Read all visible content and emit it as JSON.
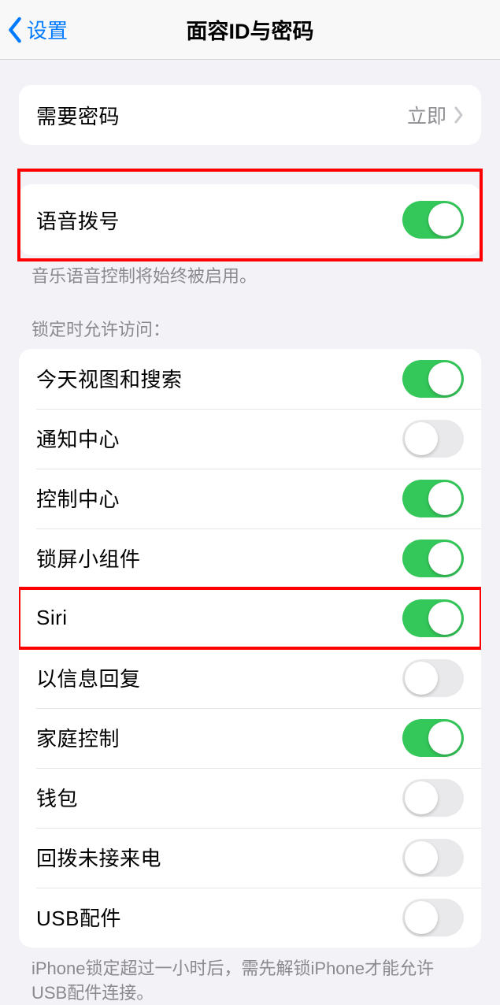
{
  "header": {
    "back_label": "设置",
    "title": "面容ID与密码"
  },
  "passcode": {
    "label": "需要密码",
    "value": "立即"
  },
  "voice_dial": {
    "label": "语音拨号",
    "footer": "音乐语音控制将始终被启用。"
  },
  "lock_access": {
    "header": "锁定时允许访问：",
    "items": [
      {
        "label": "今天视图和搜索",
        "on": true
      },
      {
        "label": "通知中心",
        "on": false
      },
      {
        "label": "控制中心",
        "on": true
      },
      {
        "label": "锁屏小组件",
        "on": true
      },
      {
        "label": "Siri",
        "on": true
      },
      {
        "label": "以信息回复",
        "on": false
      },
      {
        "label": "家庭控制",
        "on": true
      },
      {
        "label": "钱包",
        "on": false
      },
      {
        "label": "回拨未接来电",
        "on": false
      },
      {
        "label": "USB配件",
        "on": false
      }
    ],
    "footer": "iPhone锁定超过一小时后，需先解锁iPhone才能允许USB配件连接。"
  }
}
